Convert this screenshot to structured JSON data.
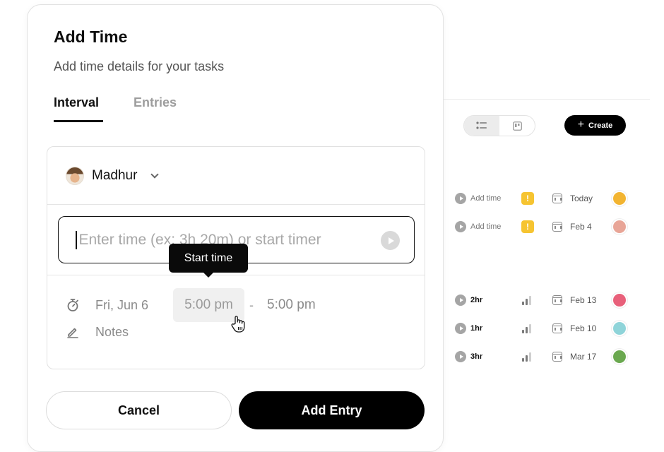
{
  "modal": {
    "title": "Add Time",
    "subtitle": "Add time details for your tasks",
    "tabs": [
      {
        "label": "Interval",
        "active": true
      },
      {
        "label": "Entries",
        "active": false
      }
    ],
    "user": {
      "name": "Madhur"
    },
    "time_input": {
      "placeholder": "Enter time (ex: 3h 20m) or start timer"
    },
    "tooltip": "Start time",
    "date": "Fri, Jun 6",
    "start_time": "5:00 pm",
    "separator": "-",
    "end_time": "5:00 pm",
    "notes_placeholder": "Notes",
    "buttons": {
      "cancel": "Cancel",
      "add": "Add Entry"
    }
  },
  "background": {
    "create_label": "Create",
    "tasks": [
      {
        "time": "Add time",
        "priority": "urgent",
        "date": "Today",
        "avatar_color": "#f2b431"
      },
      {
        "time": "Add time",
        "priority": "urgent",
        "date": "Feb 4",
        "avatar_color": "#e8a597"
      },
      {
        "time": "2hr",
        "priority": "medium",
        "date": "Feb 13",
        "avatar_color": "#e8607a"
      },
      {
        "time": "1hr",
        "priority": "medium",
        "date": "Feb 10",
        "avatar_color": "#8fd4d9"
      },
      {
        "time": "3hr",
        "priority": "medium",
        "date": "Mar 17",
        "avatar_color": "#6aa84f"
      }
    ]
  },
  "colors": {
    "urgent": "#f6c431",
    "primary": "#000000"
  }
}
